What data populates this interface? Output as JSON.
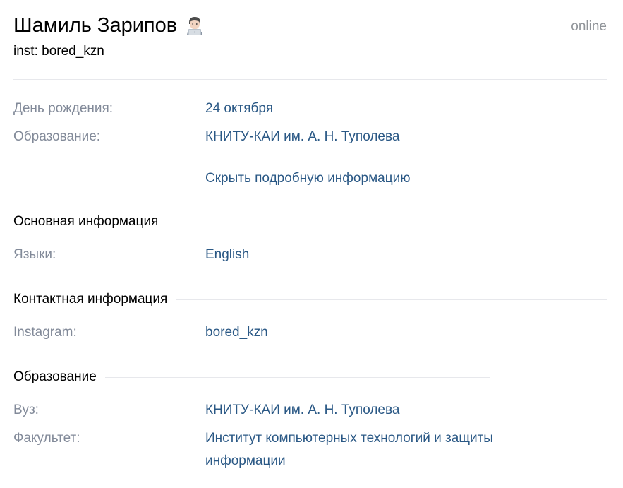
{
  "profile": {
    "name": "Шамиль Зарипов",
    "status": "inst: bored_kzn",
    "online": "online",
    "emoji_icon": "technologist-emoji-icon"
  },
  "short_info": [
    {
      "label": "День рождения:",
      "value": "24 октября"
    },
    {
      "label": "Образование:",
      "value": "КНИТУ-КАИ им. А. Н. Туполева"
    }
  ],
  "toggle_details": "Скрыть подробную информацию",
  "sections": {
    "main": {
      "title": "Основная информация",
      "rows": [
        {
          "label": "Языки:",
          "value": "English"
        }
      ]
    },
    "contacts": {
      "title": "Контактная информация",
      "rows": [
        {
          "label": "Instagram:",
          "value": "bored_kzn"
        }
      ]
    },
    "education": {
      "title": "Образование",
      "rows": [
        {
          "label": "Вуз:",
          "value": "КНИТУ-КАИ им. А. Н. Туполева"
        },
        {
          "label": "Факультет:",
          "value": "Институт компьютерных технологий и защиты информации"
        }
      ]
    }
  },
  "colors": {
    "label": "#828a99",
    "link": "#2a5885",
    "muted": "#909499",
    "divider": "#e7e8ec"
  }
}
